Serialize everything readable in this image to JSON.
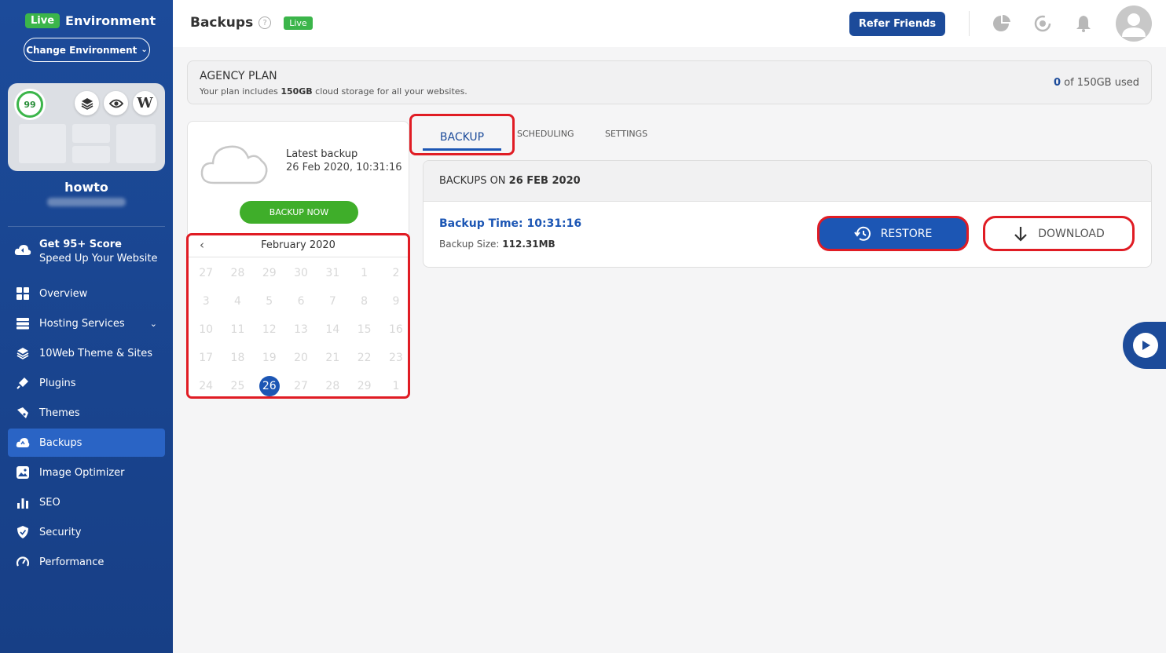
{
  "sidebar": {
    "env_badge": "Live",
    "env_title": "Environment",
    "change_env_label": "Change Environment",
    "score": "99",
    "site_name": "howto",
    "promo": {
      "title": "Get 95+ Score",
      "subtitle": "Speed Up Your Website"
    },
    "items": [
      {
        "label": "Overview",
        "icon": "grid-icon"
      },
      {
        "label": "Hosting Services",
        "icon": "server-icon"
      },
      {
        "label": "10Web Theme & Sites",
        "icon": "layers-icon"
      },
      {
        "label": "Plugins",
        "icon": "plug-icon"
      },
      {
        "label": "Themes",
        "icon": "brush-icon"
      },
      {
        "label": "Backups",
        "icon": "cloud-backup-icon",
        "active": true
      },
      {
        "label": "Image Optimizer",
        "icon": "image-icon"
      },
      {
        "label": "SEO",
        "icon": "bar-chart-icon"
      },
      {
        "label": "Security",
        "icon": "shield-icon"
      },
      {
        "label": "Performance",
        "icon": "gauge-icon"
      }
    ]
  },
  "header": {
    "title": "Backups",
    "help": "?",
    "live_label": "Live",
    "refer_label": "Refer Friends"
  },
  "plan": {
    "title": "AGENCY PLAN",
    "desc_prefix": "Your plan includes ",
    "desc_amount": "150GB",
    "desc_suffix": " cloud storage for all your websites.",
    "used_num": "0",
    "used_suffix": " of 150GB used"
  },
  "latest": {
    "label": "Latest backup",
    "date": "26 Feb 2020, 10:31:16",
    "backup_now_label": "BACKUP NOW"
  },
  "calendar": {
    "prev": "‹",
    "month": "February 2020",
    "days": [
      "27",
      "28",
      "29",
      "30",
      "31",
      "1",
      "2",
      "3",
      "4",
      "5",
      "6",
      "7",
      "8",
      "9",
      "10",
      "11",
      "12",
      "13",
      "14",
      "15",
      "16",
      "17",
      "18",
      "19",
      "20",
      "21",
      "22",
      "23",
      "24",
      "25",
      "26",
      "27",
      "28",
      "29",
      "1"
    ],
    "selected_day": "26"
  },
  "tabs": {
    "backup": "BACKUP",
    "scheduling": "SCHEDULING",
    "settings": "SETTINGS"
  },
  "backups_panel": {
    "head_prefix": "BACKUPS ON ",
    "head_date": "26 FEB 2020",
    "time": "Backup Time: 10:31:16",
    "size_label": "Backup Size: ",
    "size_value": "112.31MB",
    "restore_label": "RESTORE",
    "download_label": "DOWNLOAD"
  },
  "colors": {
    "brand": "#1c4b9a",
    "accent_blue": "#1c56b4",
    "live_green": "#3bb54a",
    "highlight_red": "#e01c24"
  }
}
